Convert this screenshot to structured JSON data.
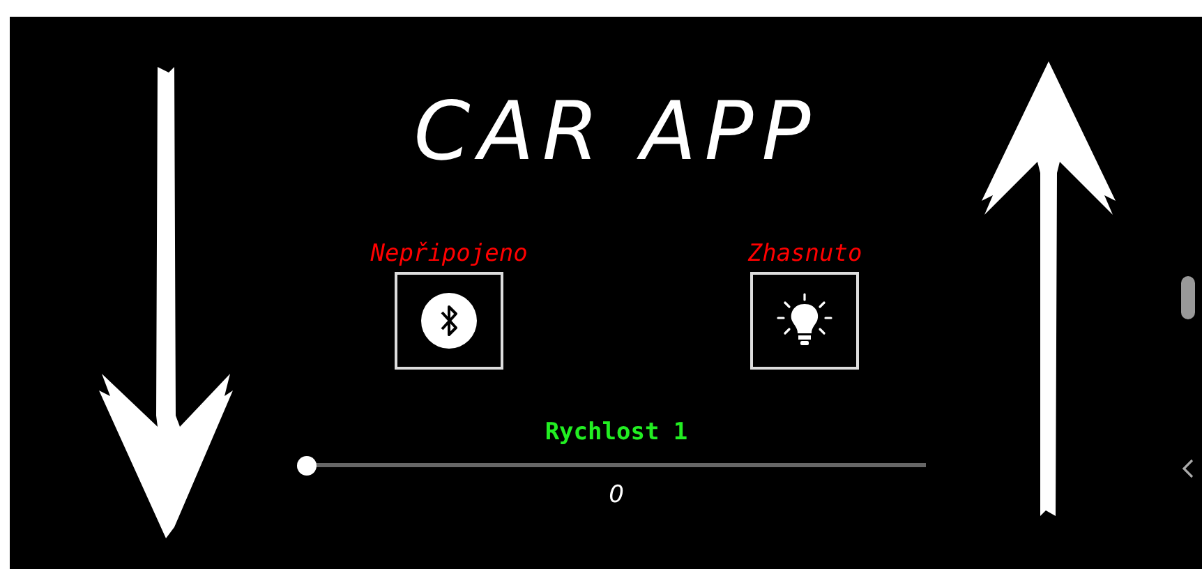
{
  "title": "CAR APP",
  "statuses": [
    {
      "kind": "bluetooth",
      "label": "Nepřipojeno",
      "on": false
    },
    {
      "kind": "light",
      "label": "Zhasnuto",
      "on": false
    }
  ],
  "speed": {
    "label": "Rychlost 1",
    "level": 0,
    "value": "0"
  }
}
